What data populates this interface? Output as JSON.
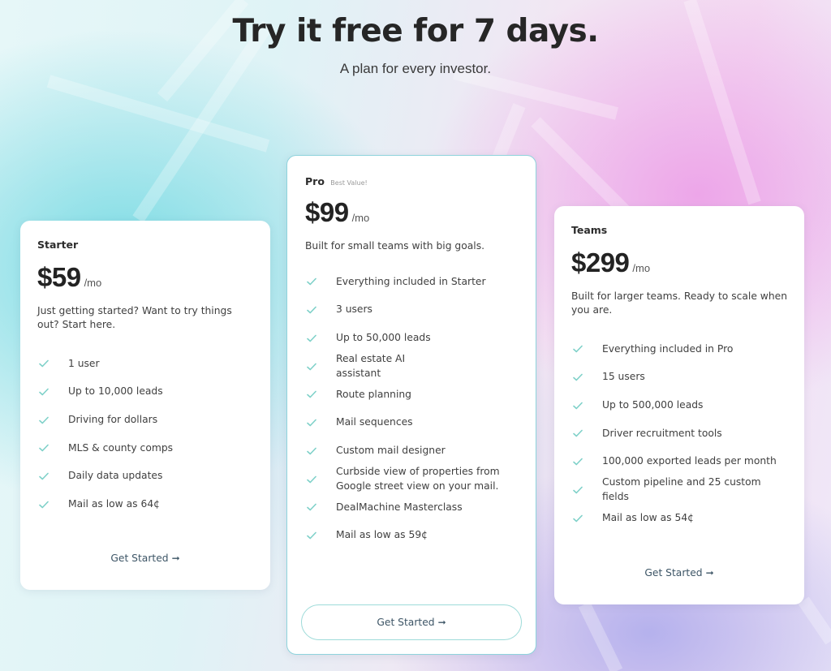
{
  "header": {
    "title": "Try it free for 7 days.",
    "subtitle": "A plan for every investor."
  },
  "colors": {
    "check": "#7fd1c9",
    "pro_border": "#8ed3dc",
    "cta_text": "#3d5566"
  },
  "plans": [
    {
      "name": "Starter",
      "tag": "",
      "price": "$59",
      "period": "/mo",
      "description": "Just getting started? Want to try things out? Start here.",
      "features": [
        "1 user",
        "Up to 10,000 leads",
        "Driving for dollars",
        "MLS & county comps",
        "Daily data updates",
        "Mail as low as 64¢"
      ],
      "cta": "Get Started",
      "cta_icon": "arrow-right-icon"
    },
    {
      "name": "Pro",
      "tag": "Best Value!",
      "price": "$99",
      "period": "/mo",
      "description": "Built for small teams with big goals.",
      "features": [
        "Everything included in Starter",
        "3 users",
        "Up to 50,000 leads",
        "Real estate AI\nassistant",
        "Route planning",
        "Mail sequences",
        "Custom mail designer",
        "Curbside view of properties from Google street view on your mail.",
        "DealMachine Masterclass",
        "Mail as low as 59¢"
      ],
      "cta": "Get Started",
      "cta_icon": "arrow-right-icon"
    },
    {
      "name": "Teams",
      "tag": "",
      "price": "$299",
      "period": "/mo",
      "description": "Built for larger teams. Ready to scale when you are.",
      "features": [
        "Everything included in Pro",
        "15 users",
        "Up to 500,000 leads",
        "Driver recruitment tools",
        "100,000 exported leads per month",
        "Custom pipeline and 25 custom fields",
        "Mail as low as 54¢"
      ],
      "cta": "Get Started",
      "cta_icon": "arrow-right-icon"
    }
  ]
}
